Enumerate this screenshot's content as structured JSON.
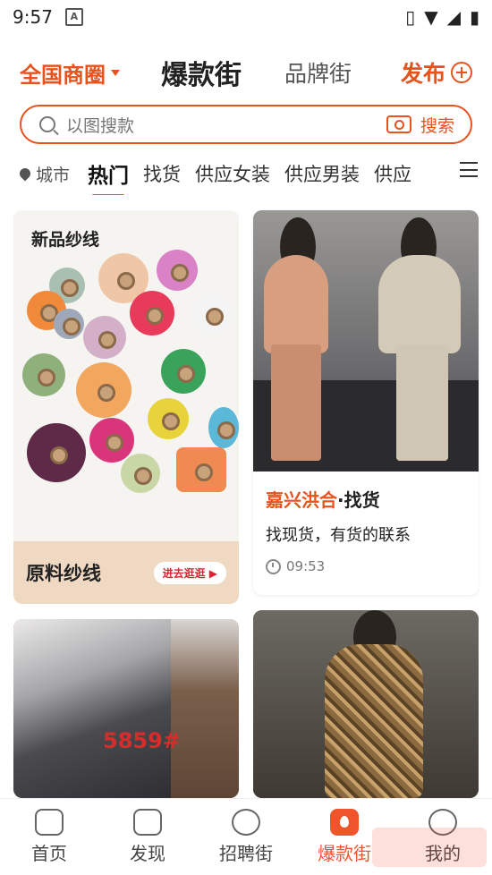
{
  "status_bar": {
    "time": "9:57"
  },
  "top_nav": {
    "region": "全国商圈",
    "main_tab": "爆款街",
    "brand_tab": "品牌街",
    "publish": "发布"
  },
  "search": {
    "placeholder": "以图搜款",
    "button": "搜索"
  },
  "categories": {
    "city": "城市",
    "items": [
      "热门",
      "找货",
      "供应女装",
      "供应男装",
      "供应"
    ]
  },
  "feed": {
    "ad": {
      "title": "新品纱线",
      "banner": "原料纱线",
      "button": "进去逛逛 ▶"
    },
    "post1": {
      "shop": "嘉兴洪合",
      "type": "·找货",
      "desc": "找现货，有货的联系",
      "time": "09:53"
    },
    "post2": {
      "price_tag": "5859#"
    }
  },
  "bottom_nav": {
    "items": [
      {
        "label": "首页",
        "icon": "home-icon"
      },
      {
        "label": "发现",
        "icon": "discover-icon"
      },
      {
        "label": "招聘街",
        "icon": "recruit-icon"
      },
      {
        "label": "爆款街",
        "icon": "fire-icon"
      },
      {
        "label": "我的",
        "icon": "profile-icon"
      }
    ]
  },
  "colors": {
    "accent": "#e8521d"
  }
}
